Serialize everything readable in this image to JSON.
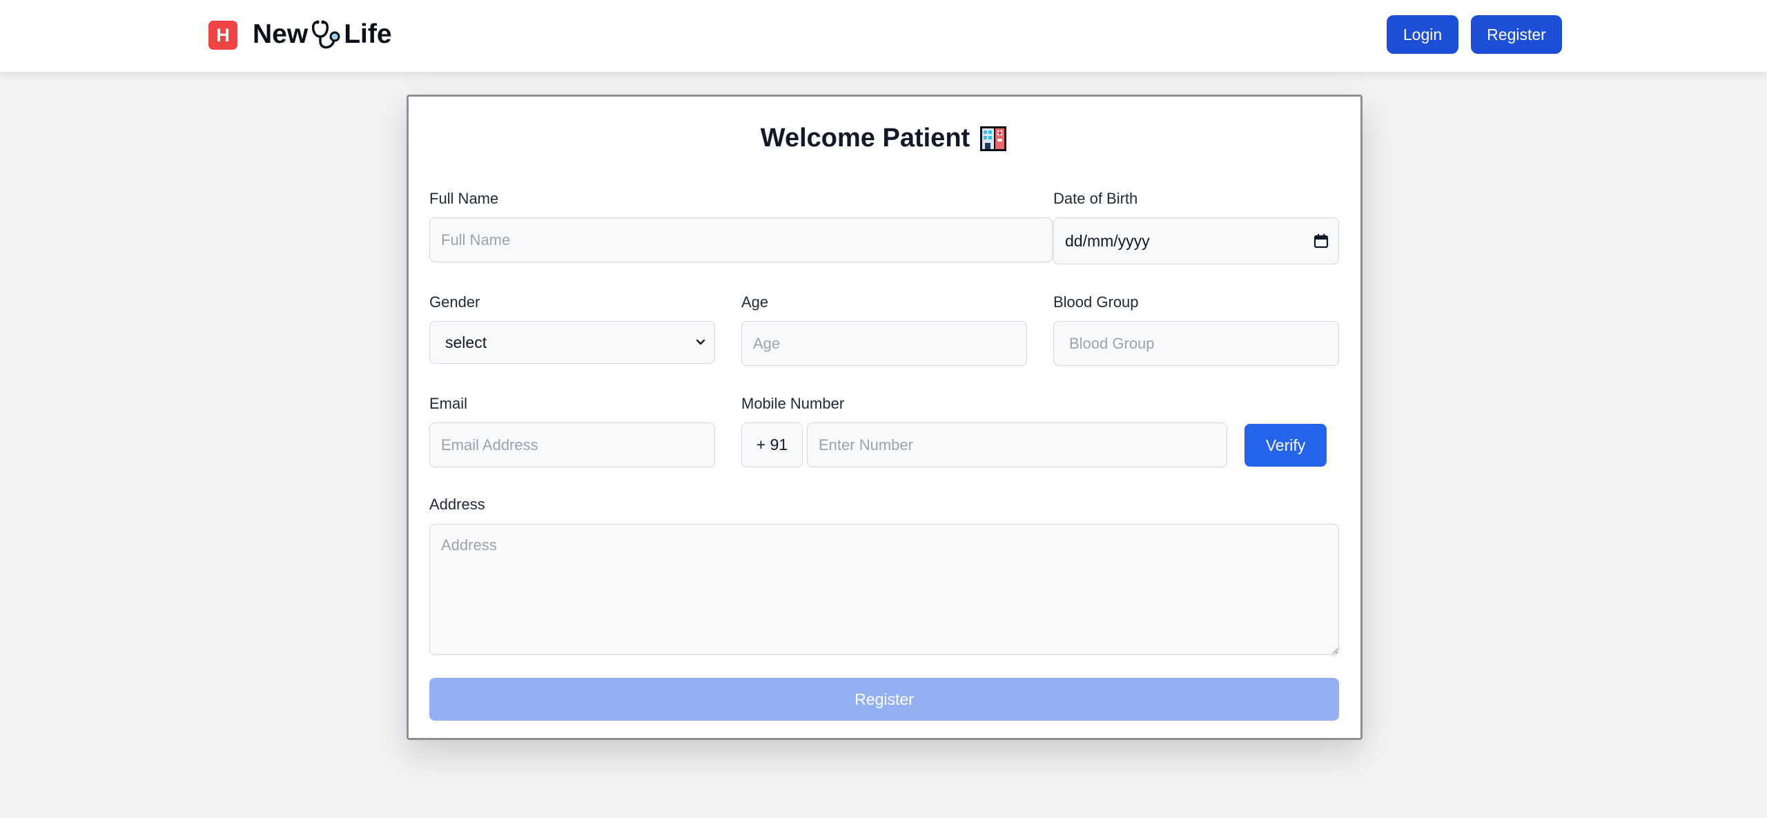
{
  "header": {
    "logo_letter": "H",
    "brand_part1": "New",
    "brand_part2": "Life",
    "stethoscope_icon": "stethoscope-icon",
    "login_label": "Login",
    "register_label": "Register"
  },
  "form": {
    "title": "Welcome Patient",
    "title_icon": "hospital-icon",
    "full_name": {
      "label": "Full Name",
      "placeholder": "Full Name",
      "value": ""
    },
    "dob": {
      "label": "Date of Birth",
      "value": "dd/mm/yyyy",
      "icon": "calendar-icon"
    },
    "gender": {
      "label": "Gender",
      "value": "select",
      "icon": "chevron-down-icon"
    },
    "age": {
      "label": "Age",
      "placeholder": "Age",
      "value": ""
    },
    "blood_group": {
      "label": "Blood Group",
      "placeholder": "Blood Group",
      "value": ""
    },
    "email": {
      "label": "Email",
      "placeholder": "Email Address",
      "value": ""
    },
    "mobile": {
      "label": "Mobile Number",
      "prefix": "+ 91",
      "placeholder": "Enter Number",
      "value": "",
      "verify_label": "Verify"
    },
    "address": {
      "label": "Address",
      "placeholder": "Address",
      "value": ""
    },
    "submit_label": "Register"
  },
  "colors": {
    "primary": "#1d4ed8",
    "verify": "#2563eb",
    "submit_disabled": "#93b0f4",
    "logo": "#ef4444"
  }
}
